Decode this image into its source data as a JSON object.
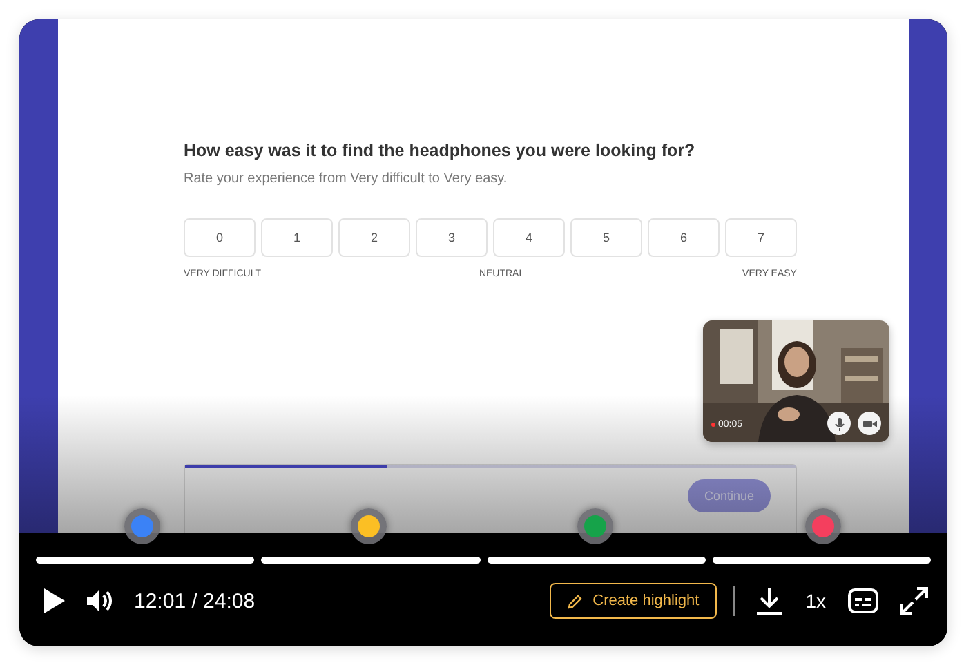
{
  "survey": {
    "question": "How easy was it to find the headphones you were looking for?",
    "hint": "Rate your experience from Very difficult to Very easy.",
    "scale": [
      {
        "label": "0"
      },
      {
        "label": "1"
      },
      {
        "label": "2"
      },
      {
        "label": "3"
      },
      {
        "label": "4"
      },
      {
        "label": "5"
      },
      {
        "label": "6"
      },
      {
        "label": "7"
      }
    ],
    "anchors": [
      "VERY DIFFICULT",
      "NEUTRAL",
      "VERY EASY"
    ],
    "progress": {
      "level": 0.33
    },
    "continue_label": "Continue"
  },
  "webcam": {
    "kind": "picture",
    "timer": "00:05"
  },
  "markers": [
    {
      "color": "#3b82f6"
    },
    {
      "color": "#fbbf24"
    },
    {
      "color": "#16a34a"
    },
    {
      "color": "#f43f5e"
    }
  ],
  "controls": {
    "playing": false,
    "time": "12:01 / 24:08",
    "highlight_label": "Create highlight",
    "speed": "1x"
  }
}
